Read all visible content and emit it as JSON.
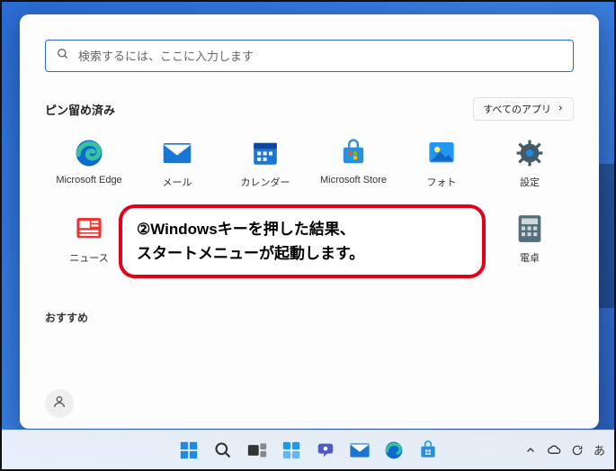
{
  "search": {
    "placeholder": "検索するには、ここに入力します"
  },
  "pinned": {
    "title": "ピン留め済み",
    "all_apps_label": "すべてのアプリ",
    "apps": [
      {
        "label": "Microsoft Edge",
        "icon": "edge"
      },
      {
        "label": "メール",
        "icon": "mail"
      },
      {
        "label": "カレンダー",
        "icon": "calendar"
      },
      {
        "label": "Microsoft Store",
        "icon": "store"
      },
      {
        "label": "フォト",
        "icon": "photos"
      },
      {
        "label": "設定",
        "icon": "settings"
      },
      {
        "label": "ニュース",
        "icon": "news"
      },
      {
        "label": "",
        "icon": ""
      },
      {
        "label": "",
        "icon": ""
      },
      {
        "label": "",
        "icon": ""
      },
      {
        "label": "",
        "icon": ""
      },
      {
        "label": "電卓",
        "icon": "calculator"
      }
    ]
  },
  "callout": {
    "line1": "②Windowsキーを押した結果、",
    "line2": "スタートメニューが起動します。"
  },
  "recommended": {
    "title": "おすすめ"
  },
  "taskbar": {
    "items": [
      {
        "name": "start",
        "icon": "start"
      },
      {
        "name": "search",
        "icon": "search"
      },
      {
        "name": "taskview",
        "icon": "taskview"
      },
      {
        "name": "widgets",
        "icon": "widgets"
      },
      {
        "name": "chat",
        "icon": "chat"
      },
      {
        "name": "mail",
        "icon": "mail"
      },
      {
        "name": "edge",
        "icon": "edge"
      },
      {
        "name": "store",
        "icon": "store"
      }
    ],
    "tray": {
      "chevron": "^",
      "cloud": "cloud",
      "battery": "battery",
      "ime": "あ"
    }
  }
}
